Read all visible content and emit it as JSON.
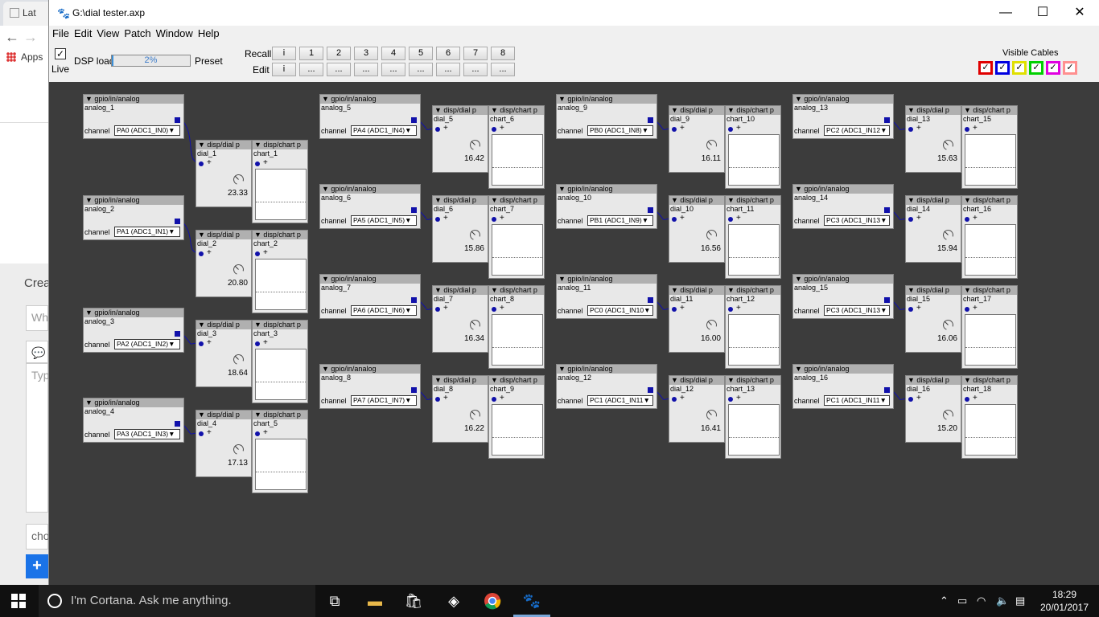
{
  "browser": {
    "tab_label": "Lat",
    "apps_label": "Apps",
    "create_label": "Crea",
    "input1_placeholder": "Wh",
    "input2_placeholder": "Typ",
    "input3_text": "cho"
  },
  "window": {
    "title": "G:\\dial tester.axp",
    "minimize": "—",
    "maximize": "☐",
    "close": "✕"
  },
  "menu": [
    "File",
    "Edit",
    "View",
    "Patch",
    "Window",
    "Help"
  ],
  "toolbar": {
    "live_label": "Live",
    "live_checked": "✓",
    "dsp_label": "DSP load",
    "dsp_value": "2%",
    "dsp_fraction": 0.02,
    "preset_label": "Preset",
    "recall_label": "Recall",
    "edit_label": "Edit",
    "recall_buttons": [
      "i",
      "1",
      "2",
      "3",
      "4",
      "5",
      "6",
      "7",
      "8"
    ],
    "edit_buttons": [
      "i",
      "...",
      "...",
      "...",
      "...",
      "...",
      "...",
      "...",
      "..."
    ],
    "visible_cables_label": "Visible Cables",
    "cable_colors": [
      "#e00000",
      "#0000e0",
      "#e0e000",
      "#00d000",
      "#e000e0",
      "#ff9090"
    ],
    "cable_check": "✓"
  },
  "canvas": {
    "analog_header": "▼ gpio/in/analog",
    "dial_header": "▼ disp/dial p",
    "chart_header": "▼ disp/chart p",
    "channel_label": "channel",
    "plus": "+",
    "analogs": [
      {
        "name": "analog_1",
        "channel": "PA0 (ADC1_IN0)▼"
      },
      {
        "name": "analog_2",
        "channel": "PA1 (ADC1_IN1)▼"
      },
      {
        "name": "analog_3",
        "channel": "PA2 (ADC1_IN2)▼"
      },
      {
        "name": "analog_4",
        "channel": "PA3 (ADC1_IN3)▼"
      },
      {
        "name": "analog_5",
        "channel": "PA4 (ADC1_IN4)▼"
      },
      {
        "name": "analog_6",
        "channel": "PA5 (ADC1_IN5)▼"
      },
      {
        "name": "analog_7",
        "channel": "PA6 (ADC1_IN6)▼"
      },
      {
        "name": "analog_8",
        "channel": "PA7 (ADC1_IN7)▼"
      },
      {
        "name": "analog_9",
        "channel": "PB0 (ADC1_IN8)▼"
      },
      {
        "name": "analog_10",
        "channel": "PB1 (ADC1_IN9)▼"
      },
      {
        "name": "analog_11",
        "channel": "PC0 (ADC1_IN10▼"
      },
      {
        "name": "analog_12",
        "channel": "PC1 (ADC1_IN11▼"
      },
      {
        "name": "analog_13",
        "channel": "PC2 (ADC1_IN12▼"
      },
      {
        "name": "analog_14",
        "channel": "PC3 (ADC1_IN13▼"
      },
      {
        "name": "analog_15",
        "channel": "PC3 (ADC1_IN13▼"
      },
      {
        "name": "analog_16",
        "channel": "PC1 (ADC1_IN11▼"
      }
    ],
    "dials": [
      {
        "name": "dial_1",
        "value": "23.33",
        "chart": "chart_1"
      },
      {
        "name": "dial_2",
        "value": "20.80",
        "chart": "chart_2"
      },
      {
        "name": "dial_3",
        "value": "18.64",
        "chart": "chart_3"
      },
      {
        "name": "dial_4",
        "value": "17.13",
        "chart": "chart_5"
      },
      {
        "name": "dial_5",
        "value": "16.42",
        "chart": "chart_6"
      },
      {
        "name": "dial_6",
        "value": "15.86",
        "chart": "chart_7"
      },
      {
        "name": "dial_7",
        "value": "16.34",
        "chart": "chart_8"
      },
      {
        "name": "dial_8",
        "value": "16.22",
        "chart": "chart_9"
      },
      {
        "name": "dial_9",
        "value": "16.11",
        "chart": "chart_10"
      },
      {
        "name": "dial_10",
        "value": "16.56",
        "chart": "chart_11"
      },
      {
        "name": "dial_11",
        "value": "16.00",
        "chart": "chart_12"
      },
      {
        "name": "dial_12",
        "value": "16.41",
        "chart": "chart_13"
      },
      {
        "name": "dial_13",
        "value": "15.63",
        "chart": "chart_15"
      },
      {
        "name": "dial_14",
        "value": "15.94",
        "chart": "chart_16"
      },
      {
        "name": "dial_15",
        "value": "16.06",
        "chart": "chart_17"
      },
      {
        "name": "dial_16",
        "value": "15.20",
        "chart": "chart_18"
      }
    ]
  },
  "taskbar": {
    "search_text": "I'm Cortana. Ask me anything.",
    "time": "18:29",
    "date": "20/01/2017"
  }
}
